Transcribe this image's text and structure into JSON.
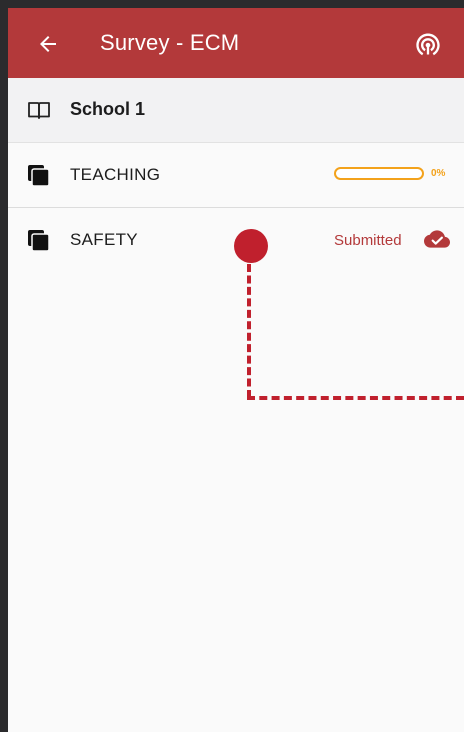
{
  "app_bar": {
    "title": "Survey - ECM",
    "back_icon": "arrow-back-icon",
    "action_icon": "wifi-tethering-icon",
    "color": "#b3393a"
  },
  "school": {
    "label": "School 1",
    "icon": "book-open-icon"
  },
  "sections": [
    {
      "label": "TEACHING",
      "icon": "stack-icon",
      "progress_percent": 0,
      "progress_text": "0%",
      "progress_color": "#f3a21b"
    },
    {
      "label": "SAFETY",
      "icon": "stack-icon",
      "status": "Submitted",
      "status_icon": "cloud-done-icon",
      "status_color": "#b3393a"
    }
  ],
  "annotation": {
    "marker_color": "#c0202d"
  }
}
